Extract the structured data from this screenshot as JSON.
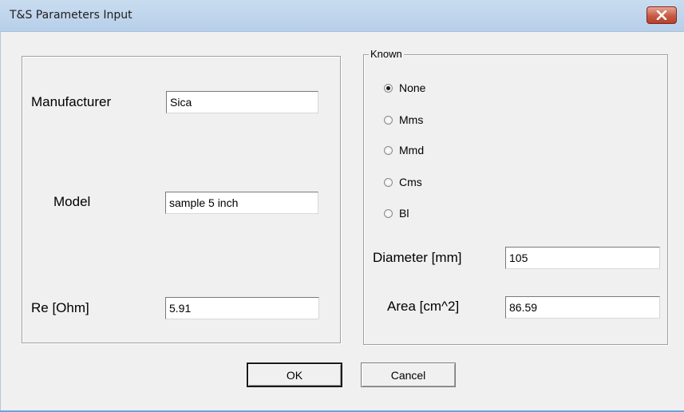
{
  "window": {
    "title": "T&S Parameters Input"
  },
  "left": {
    "manufacturer_label": "Manufacturer",
    "manufacturer_value": "Sica",
    "model_label": "Model",
    "model_value": "sample 5 inch",
    "re_label": "Re [Ohm]",
    "re_value": "5.91"
  },
  "known": {
    "legend": "Known",
    "options": [
      {
        "label": "None",
        "selected": true
      },
      {
        "label": "Mms",
        "selected": false
      },
      {
        "label": "Mmd",
        "selected": false
      },
      {
        "label": "Cms",
        "selected": false
      },
      {
        "label": "Bl",
        "selected": false
      }
    ],
    "diameter_label": "Diameter [mm]",
    "diameter_value": "105",
    "area_label": "Area [cm^2]",
    "area_value": "86.59"
  },
  "buttons": {
    "ok": "OK",
    "cancel": "Cancel"
  }
}
